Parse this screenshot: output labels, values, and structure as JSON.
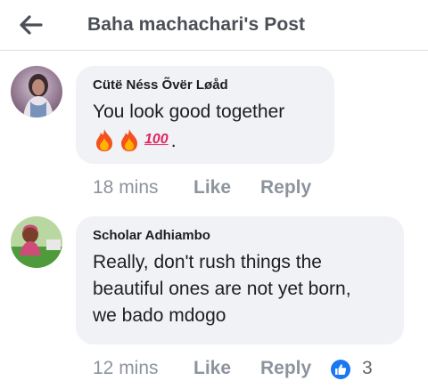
{
  "header": {
    "title": "Baha machachari's Post"
  },
  "comments": [
    {
      "author": "Cütë Néss Õvër Løåd",
      "text_line1": "You look good together",
      "emojis": [
        "fire-emoji",
        "fire-emoji",
        "hundred-points-emoji"
      ],
      "hundred_label": "100",
      "trailing": ".",
      "time": "18 mins",
      "like_label": "Like",
      "reply_label": "Reply"
    },
    {
      "author": "Scholar Adhiambo",
      "text_lines": [
        "Really, don't rush things the",
        "beautiful ones are not yet born,",
        "we bado mdogo"
      ],
      "time": "12 mins",
      "like_label": "Like",
      "reply_label": "Reply",
      "reaction_count": "3",
      "reaction_icon": "thumbs-up-icon",
      "reaction_color": "#1877f2"
    }
  ],
  "colors": {
    "bubble_bg": "#f0f2f5",
    "meta_gray": "#8d949e",
    "header_text": "#4b4f56",
    "like_blue": "#1877f2"
  }
}
